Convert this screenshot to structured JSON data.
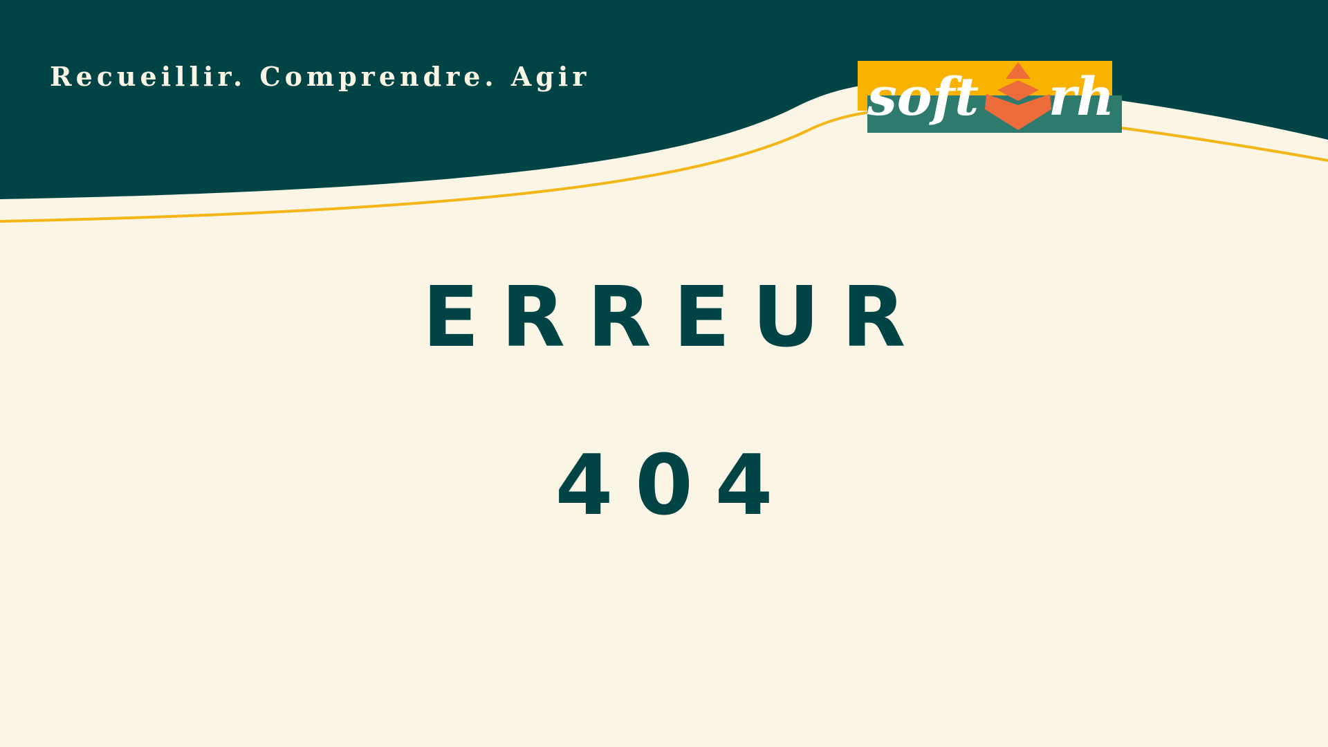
{
  "header": {
    "tagline": "Recueillir. Comprendre. Agir"
  },
  "logo": {
    "text_left": "soft",
    "text_right": "rh",
    "icon": "chevron-pyramid-icon"
  },
  "main": {
    "title": "ERREUR",
    "code": "404"
  },
  "colors": {
    "background": "#FAF5E4",
    "header_band": "#014446",
    "accent_line": "#F3B517",
    "logo_yellow": "#F7B300",
    "logo_green": "#2E7B6E",
    "logo_orange": "#EE6B3A",
    "text_primary": "#014446"
  }
}
